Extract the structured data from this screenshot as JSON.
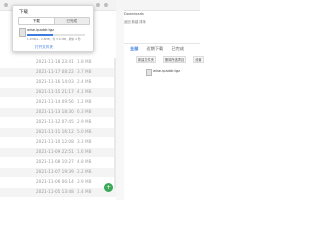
{
  "download_popup": {
    "title": "下载",
    "tabs": [
      "下载",
      "已完成"
    ],
    "item": {
      "file_name": "wise.ipaddr.tgz",
      "status": "1.2MB/s - 2.8MB，共 5.6 MB，剩余 4 秒",
      "progress": 0.45
    },
    "open_folder_label": "打开文件夹"
  },
  "list": {
    "rows": [
      {
        "date": "2021-11-18 23:41",
        "size": "1.8 MB"
      },
      {
        "date": "2021-11-17 08:22",
        "size": "3.7 MB"
      },
      {
        "date": "2021-11-16 14:03",
        "size": "2.4 MB"
      },
      {
        "date": "2021-11-15 21:17",
        "size": "4.1 MB"
      },
      {
        "date": "2021-11-14 09:56",
        "size": "1.2 MB"
      },
      {
        "date": "2021-11-13 18:30",
        "size": "6.3 MB"
      },
      {
        "date": "2021-11-12 07:45",
        "size": "2.9 MB"
      },
      {
        "date": "2021-11-11 16:12",
        "size": "5.0 MB"
      },
      {
        "date": "2021-11-10 12:08",
        "size": "3.3 MB"
      },
      {
        "date": "2021-11-09 22:51",
        "size": "1.6 MB"
      },
      {
        "date": "2021-11-08 10:27",
        "size": "4.8 MB"
      },
      {
        "date": "2021-11-07 19:39",
        "size": "2.2 MB"
      },
      {
        "date": "2021-11-06 06:14",
        "size": "3.9 MB"
      },
      {
        "date": "2021-11-05 13:48",
        "size": "1.4 MB"
      }
    ]
  },
  "fab_label": "+",
  "right_window": {
    "path": "Downloads",
    "toolbar_text": "返回   新建   排序",
    "tabs": [
      "全部",
      "近期下载",
      "已完成"
    ],
    "actions": [
      "新建文件夹",
      "删除所选项目",
      "设置"
    ],
    "file_name": "wise.ipaddr.tgz"
  }
}
